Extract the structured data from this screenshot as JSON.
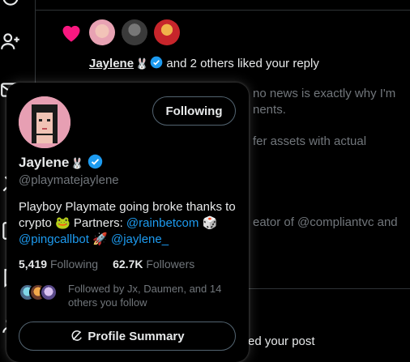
{
  "notification": {
    "liker_name": "Jaylene",
    "liked_text": "and 2 others liked your reply"
  },
  "background": {
    "line1": "no news is exactly why I'm",
    "line2": "nents.",
    "line3": "fer assets with actual",
    "line4": "eator of @compliantvc and",
    "line5": "ed your post"
  },
  "hover_card": {
    "follow_label": "Following",
    "display_name": "Jaylene",
    "handle": "@playmatejaylene",
    "bio": {
      "part1": "Playboy Playmate going broke thanks to crypto",
      "frog": "🐸",
      "partners": "Partners:",
      "link1": "@rainbetcom",
      "dice": "🎲",
      "link2": "@pingcallbot",
      "rocket": "🚀",
      "link3": "@jaylene_"
    },
    "following_count": "5,419",
    "following_label": "Following",
    "followers_count": "62.7K",
    "followers_label": "Followers",
    "followed_by": "Followed by Jx, Daumen, and 14 others you follow",
    "summary_label": "Profile Summary"
  },
  "icons": {
    "verified_color": "#1d9bf0",
    "heart_color": "#f91880",
    "link_color": "#1d9bf0"
  }
}
